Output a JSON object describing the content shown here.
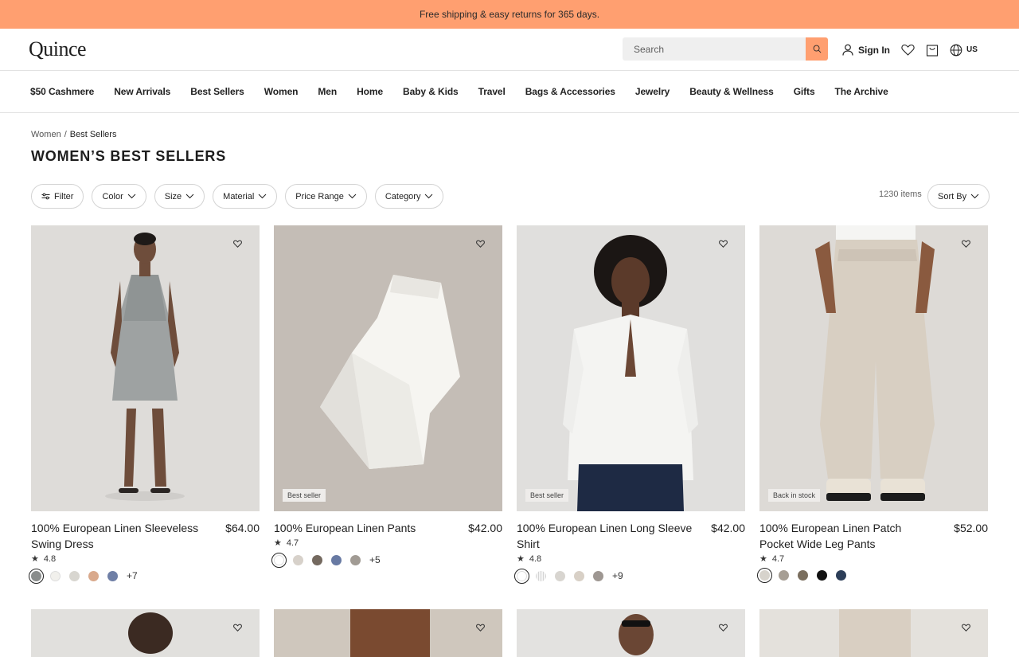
{
  "promo": {
    "text": "Free shipping & easy returns for 365 days."
  },
  "header": {
    "logo": "Quince",
    "search_placeholder": "Search",
    "sign_in": "Sign In",
    "locale": "US"
  },
  "nav": {
    "items": [
      "$50 Cashmere",
      "New Arrivals",
      "Best Sellers",
      "Women",
      "Men",
      "Home",
      "Baby & Kids",
      "Travel",
      "Bags & Accessories",
      "Jewelry",
      "Beauty & Wellness",
      "Gifts",
      "The Archive"
    ]
  },
  "breadcrumb": {
    "parent": "Women",
    "sep": "/",
    "current": "Best Sellers"
  },
  "page": {
    "title": "WOMEN’S BEST SELLERS",
    "item_count": "1230 items"
  },
  "filters": {
    "filter": "Filter",
    "color": "Color",
    "size": "Size",
    "material": "Material",
    "price_range": "Price Range",
    "category": "Category",
    "sort": "Sort By"
  },
  "products": [
    {
      "name": "100% European Linen Sleeveless Swing Dress",
      "price": "$64.00",
      "rating": "4.8",
      "badge": "",
      "more": "+7",
      "swatches": [
        "#8a8d8c",
        "#f1f0ec",
        "#d8d6d0",
        "#d9a98c",
        "#6f7fa6"
      ]
    },
    {
      "name": "100% European Linen Pants",
      "price": "$42.00",
      "rating": "4.7",
      "badge": "Best seller",
      "more": "+5",
      "swatches": [
        "#ffffff",
        "#d7d1ca",
        "#74695f",
        "#687aa3",
        "#a19b94"
      ]
    },
    {
      "name": "100% European Linen Long Sleeve Shirt",
      "price": "$42.00",
      "rating": "4.8",
      "badge": "Best seller",
      "more": "+9",
      "swatches": [
        "#ffffff",
        "#e4e2de",
        "#d8d5d0",
        "#d8d0c6",
        "#9e9792"
      ]
    },
    {
      "name": "100% European Linen Patch Pocket Wide Leg Pants",
      "price": "$52.00",
      "rating": "4.7",
      "badge": "Back in stock",
      "more": "",
      "swatches": [
        "#d7d3cc",
        "#a69e94",
        "#7a6e5e",
        "#111111",
        "#2c3e58"
      ]
    }
  ],
  "colors": {
    "accent": "#ff9f70",
    "border": "#d4d4d4"
  }
}
